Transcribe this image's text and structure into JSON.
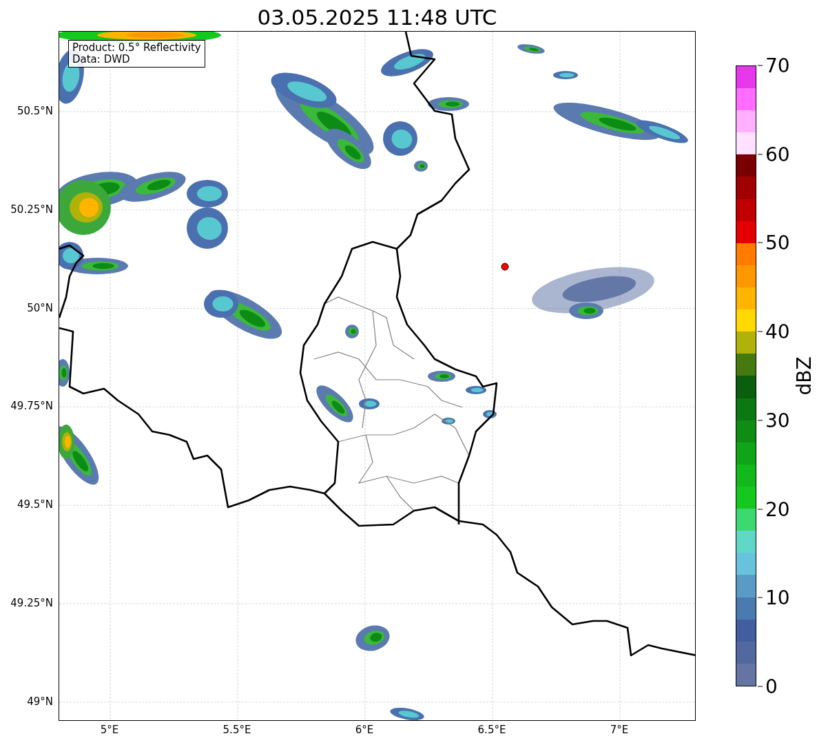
{
  "title": "03.05.2025 11:48 UTC",
  "info_box": {
    "lines": [
      "Product: 0.5° Reflectivity",
      "Data: DWD"
    ]
  },
  "map": {
    "x_ticks": [
      "5°E",
      "5.5°E",
      "6°E",
      "6.5°E",
      "7°E"
    ],
    "y_ticks": [
      "50.5°N",
      "50.25°N",
      "50°N",
      "49.75°N",
      "49.5°N",
      "49.25°N",
      "49°N"
    ]
  },
  "colorbar": {
    "label": "dBZ",
    "ticks": [
      "70",
      "60",
      "50",
      "40",
      "30",
      "20",
      "10",
      "0"
    ],
    "bins": [
      {
        "color": "#6474a4"
      },
      {
        "color": "#5468a0"
      },
      {
        "color": "#425da0"
      },
      {
        "color": "#4a7ab0"
      },
      {
        "color": "#5a9bc6"
      },
      {
        "color": "#68c2dc"
      },
      {
        "color": "#60d8c8"
      },
      {
        "color": "#3cd870"
      },
      {
        "color": "#14c81e"
      },
      {
        "color": "#12b81c"
      },
      {
        "color": "#10a418"
      },
      {
        "color": "#0e8c14"
      },
      {
        "color": "#0c7812"
      },
      {
        "color": "#0a5e0e"
      },
      {
        "color": "#467a0e"
      },
      {
        "color": "#b0b20a"
      },
      {
        "color": "#ffd800"
      },
      {
        "color": "#ffb400"
      },
      {
        "color": "#ff9800"
      },
      {
        "color": "#ff7c00"
      },
      {
        "color": "#e40000"
      },
      {
        "color": "#c00000"
      },
      {
        "color": "#a00000"
      },
      {
        "color": "#780000"
      },
      {
        "color": "#ffe0ff"
      },
      {
        "color": "#ffb0ff"
      },
      {
        "color": "#ff6cff"
      },
      {
        "color": "#e838ec"
      }
    ]
  }
}
